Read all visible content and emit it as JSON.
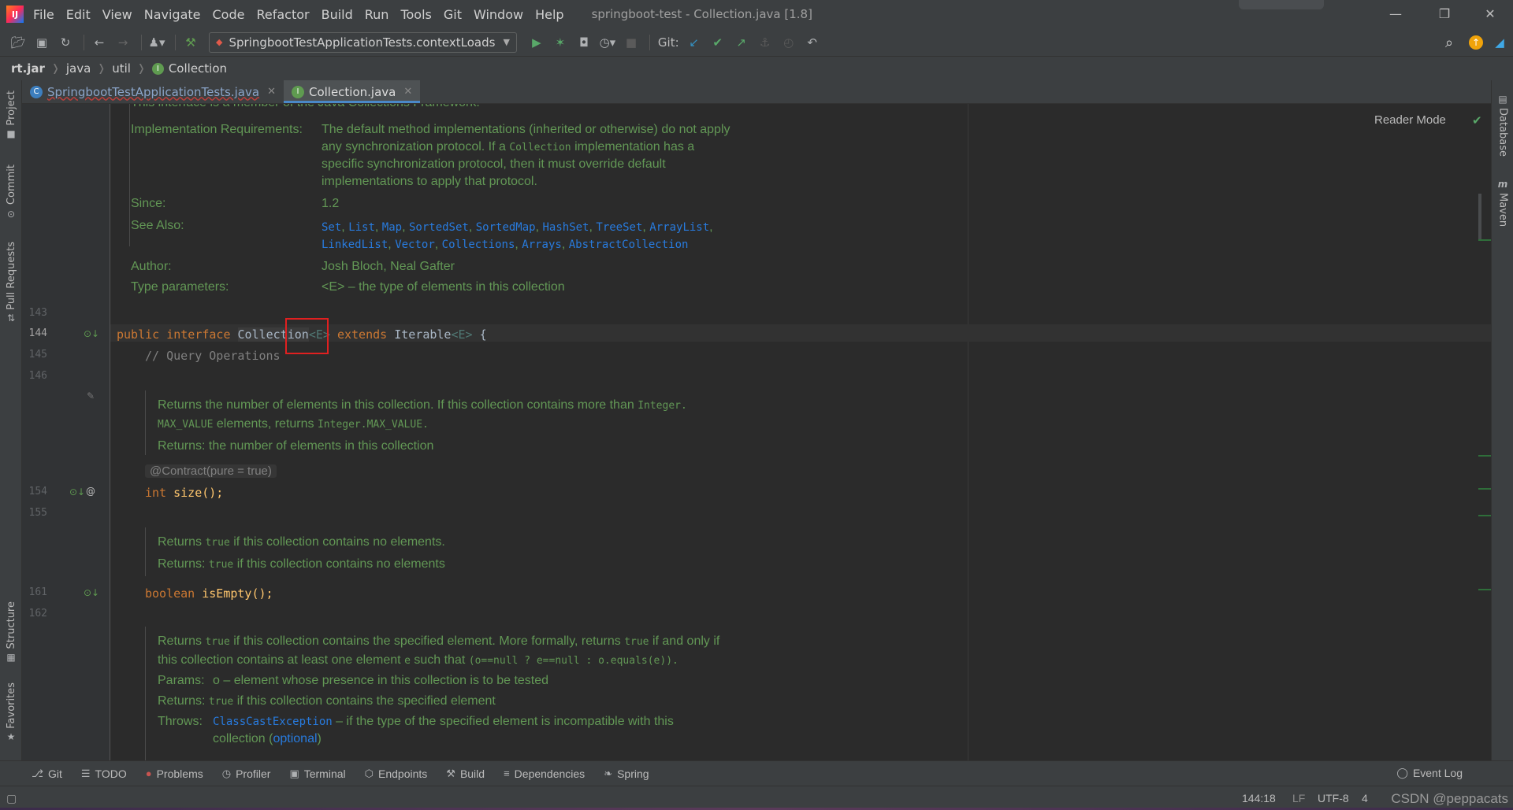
{
  "window": {
    "title": "springboot-test - Collection.java [1.8]",
    "menu": [
      "File",
      "Edit",
      "View",
      "Navigate",
      "Code",
      "Refactor",
      "Build",
      "Run",
      "Tools",
      "Git",
      "Window",
      "Help"
    ],
    "minimize_glyph": "—",
    "restore_glyph": "❐",
    "close_glyph": "✕"
  },
  "toolbar": {
    "run_config": "SpringbootTestApplicationTests.contextLoads",
    "git_label": "Git:"
  },
  "breadcrumb": [
    "rt.jar",
    "java",
    "util",
    "Collection"
  ],
  "tabs": [
    {
      "label": "SpringbootTestApplicationTests.java",
      "active": false
    },
    {
      "label": "Collection.java",
      "active": true
    }
  ],
  "left_tools": [
    "Project",
    "Commit",
    "Pull Requests",
    "Structure",
    "Favorites"
  ],
  "right_tools": [
    "Database",
    "Maven"
  ],
  "editor": {
    "reader_mode": "Reader Mode",
    "top_partial": "This interface is a member of the Java Collections Framework.",
    "impl_label": "Implementation Requirements:",
    "impl_lines": [
      "The default method implementations (inherited or otherwise) do not apply",
      "any synchronization protocol. If a",
      "Collection",
      "implementation has a",
      "specific synchronization protocol, then it must override default",
      "implementations to apply that protocol."
    ],
    "since_label": "Since:",
    "since_value": "1.2",
    "see_also_label": "See Also:",
    "see_also_line1": [
      "Set",
      "List",
      "Map",
      "SortedSet",
      "SortedMap",
      "HashSet",
      "TreeSet",
      "ArrayList"
    ],
    "see_also_line2": [
      "LinkedList",
      "Vector",
      "Collections",
      "Arrays",
      "AbstractCollection"
    ],
    "author_label": "Author:",
    "author_value": "Josh Bloch, Neal Gafter",
    "type_params_label": "Type parameters:",
    "type_params_value": "<E> – the type of elements in this collection",
    "line_numbers": [
      "143",
      "144",
      "145",
      "146",
      "154",
      "155",
      "161",
      "162"
    ],
    "line144": {
      "kw1": "public",
      "kw2": "interface",
      "name": "Collection",
      "generic": "<E>",
      "kw3": "extends",
      "super": "Iterable",
      "generic2": "<E>",
      "brace": " {"
    },
    "line145": "// Query Operations",
    "size_doc": {
      "line1a": "Returns the number of elements in this collection. If this collection contains more than",
      "line1b": "Integer.",
      "line2a": "MAX_VALUE",
      "line2b": "elements, returns",
      "line2c": "Integer.MAX_VALUE.",
      "returns": "Returns: the number of elements in this collection"
    },
    "contract": "@Contract(pure = true)",
    "line154": {
      "kw": "int",
      "rest": "size();"
    },
    "isempty_doc": {
      "line1a": "Returns",
      "line1b": "true",
      "line1c": "if this collection contains no elements.",
      "line2a": "Returns:",
      "line2b": "true",
      "line2c": "if this collection contains no elements"
    },
    "line161": {
      "kw": "boolean",
      "rest": "isEmpty();"
    },
    "contains_doc": {
      "l1a": "Returns",
      "l1b": "true",
      "l1c": "if this collection contains the specified element. More formally, returns",
      "l1d": "true",
      "l1e": "if and only if",
      "l2a": "this collection contains at least one element",
      "l2b": "e",
      "l2c": "such that",
      "l2d": "(o==null  ?  e==null  :  o.equals(e)).",
      "params_label": "Params:",
      "params_value": "o – element whose presence in this collection is to be tested",
      "returns_label": "Returns:",
      "returns_b": "true",
      "returns_c": "if this collection contains the specified element",
      "throws_label": "Throws:",
      "throws_link": "ClassCastException",
      "throws_text": "– if the type of the specified element is incompatible with this",
      "throws_l2a": "collection (",
      "throws_l2b": "optional",
      "throws_l2c": ")"
    }
  },
  "bottom_tools": [
    "Git",
    "TODO",
    "Problems",
    "Profiler",
    "Terminal",
    "Endpoints",
    "Build",
    "Dependencies",
    "Spring"
  ],
  "event_log": "Event Log",
  "status": {
    "position": "144:18",
    "line_sep": "LF",
    "encoding": "UTF-8",
    "indent": "4",
    "watermark": "CSDN @peppacats"
  }
}
